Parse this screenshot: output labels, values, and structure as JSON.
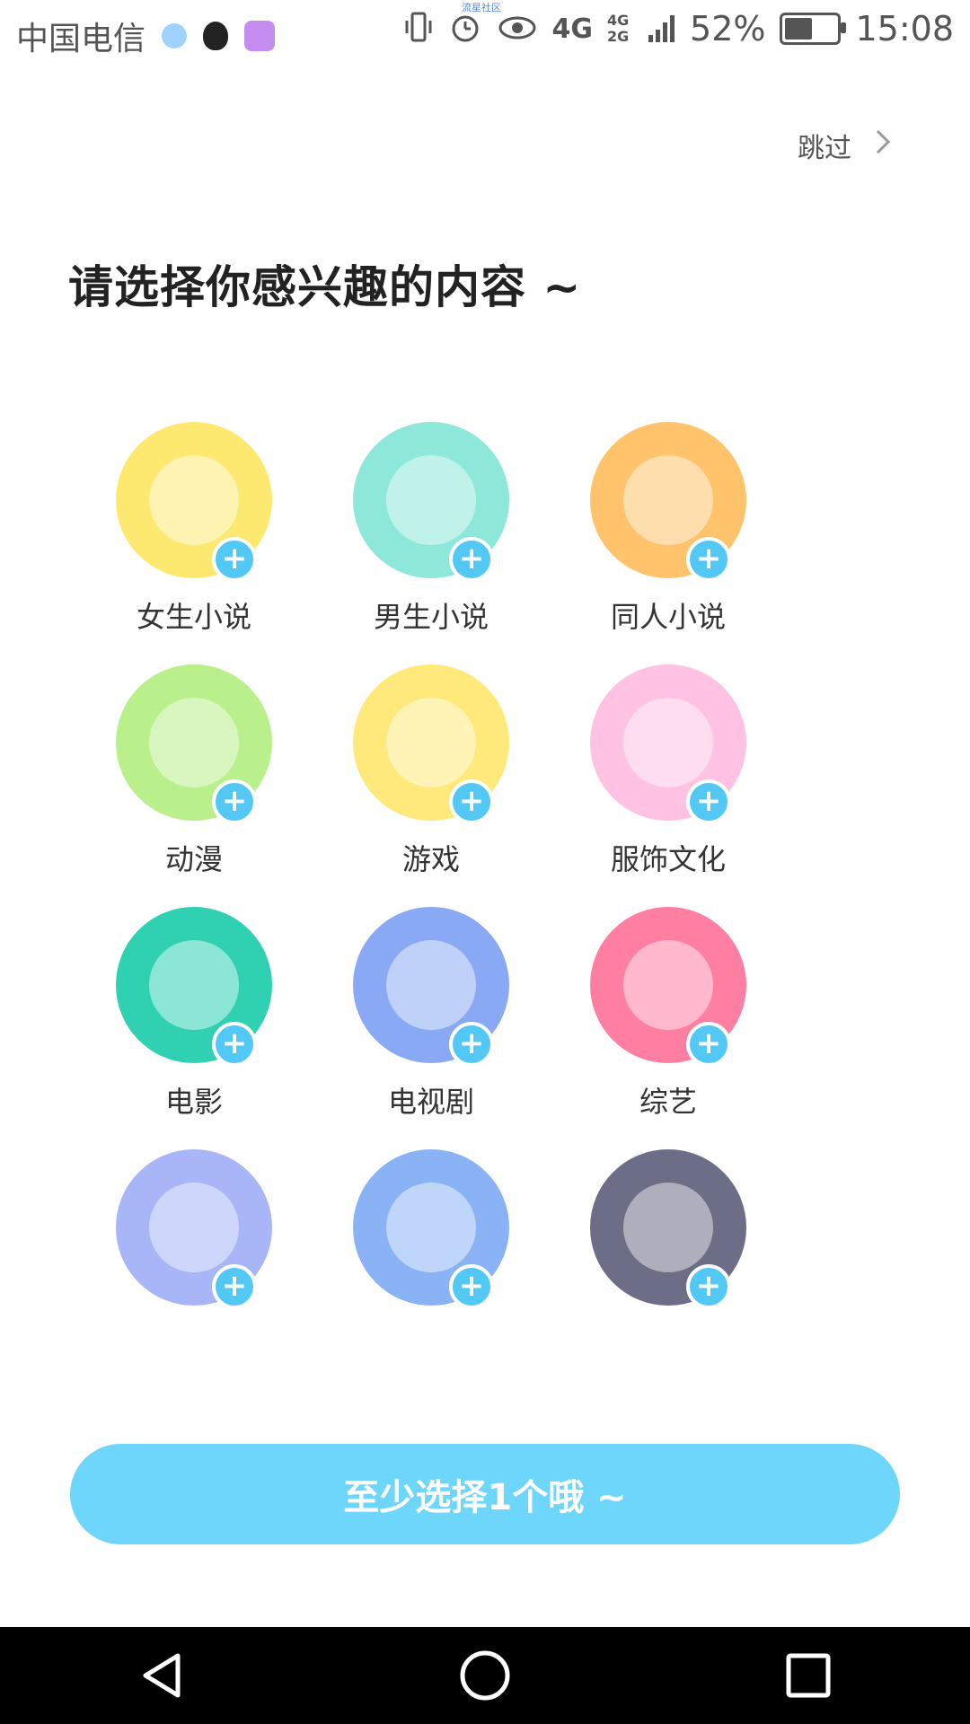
{
  "status_bar": {
    "carrier": "中国电信",
    "tiny_label": "流星社区",
    "battery_percent": "52%",
    "battery_level": 0.52,
    "network1": "4G",
    "network2": "4G 2G",
    "time": "15:08"
  },
  "header": {
    "skip_label": "跳过"
  },
  "page": {
    "title": "请选择你感兴趣的内容 ~"
  },
  "interests": [
    {
      "label": "女生小说",
      "bg": "#fde96f"
    },
    {
      "label": "男生小说",
      "bg": "#8ee8d9"
    },
    {
      "label": "同人小说",
      "bg": "#ffc46b"
    },
    {
      "label": "动漫",
      "bg": "#b9f08b"
    },
    {
      "label": "游戏",
      "bg": "#ffe97a"
    },
    {
      "label": "服饰文化",
      "bg": "#ffc2e3"
    },
    {
      "label": "电影",
      "bg": "#2fd1b2"
    },
    {
      "label": "电视剧",
      "bg": "#8aa9f4"
    },
    {
      "label": "综艺",
      "bg": "#ff7fa3"
    },
    {
      "label": "",
      "bg": "#a8b5f7"
    },
    {
      "label": "",
      "bg": "#8ab3f5"
    },
    {
      "label": "",
      "bg": "#6b6e86"
    }
  ],
  "cta": {
    "label": "至少选择1个哦 ~"
  },
  "accent": "#6fd6fb"
}
